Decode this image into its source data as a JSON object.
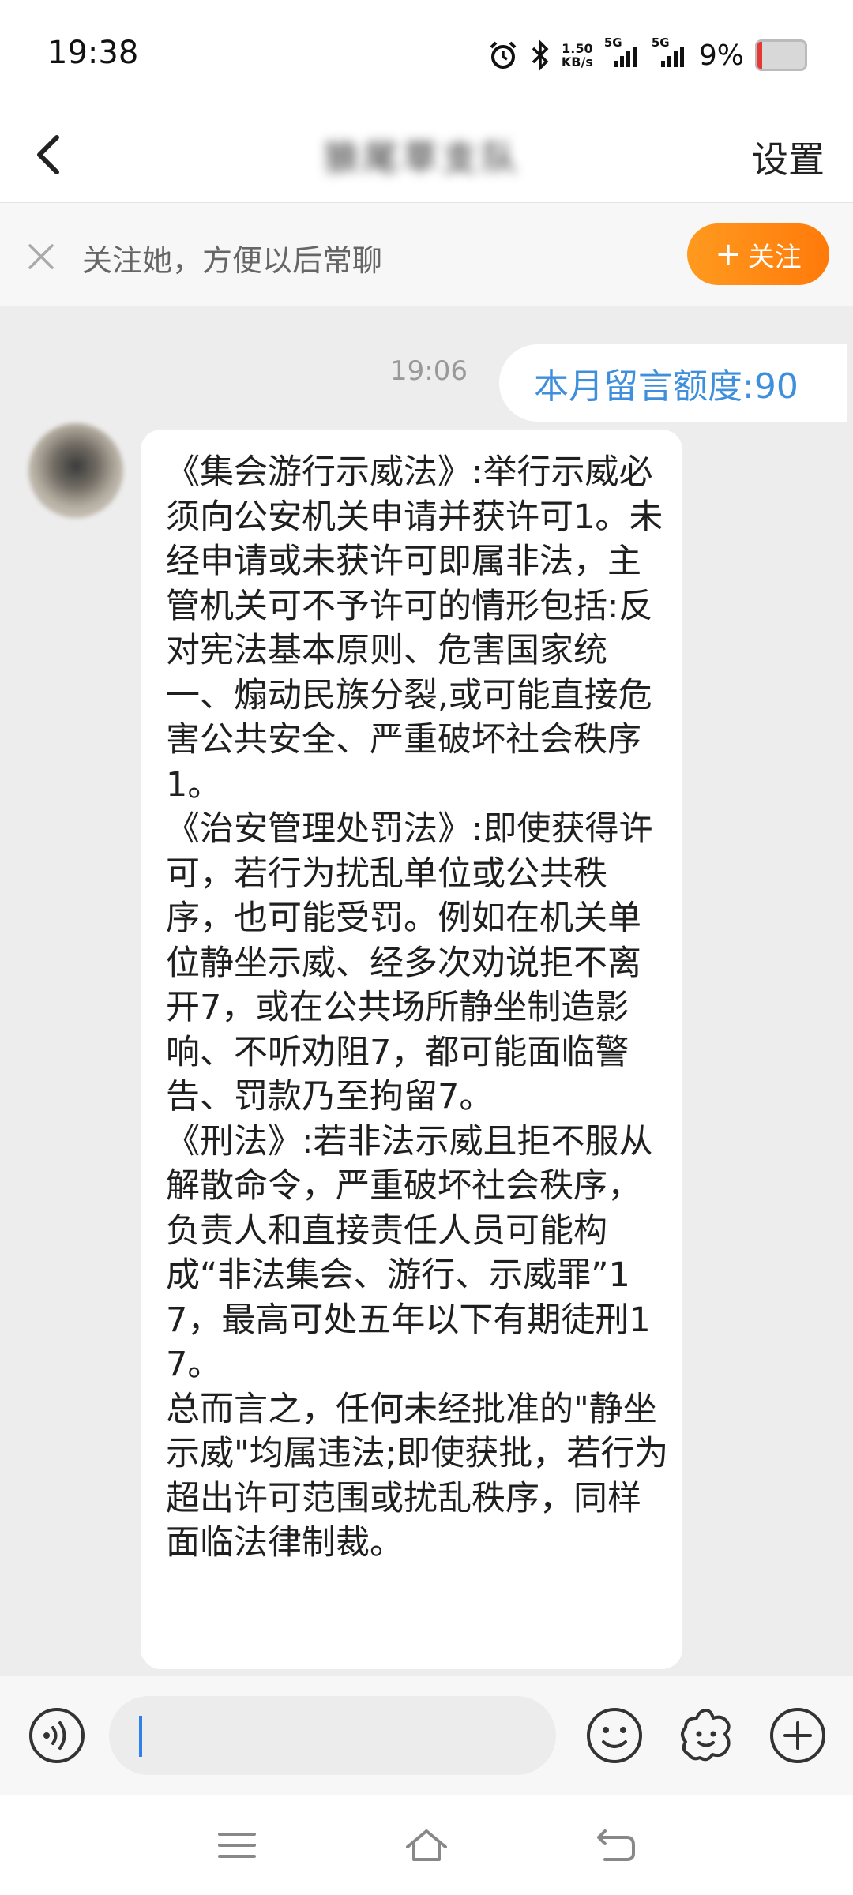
{
  "status_bar": {
    "time": "19:38",
    "net_speed_value": "1.50",
    "net_speed_unit": "KB/s",
    "sim1": "5G",
    "sim2": "5G",
    "battery_percent": "9%",
    "icons": [
      "alarm-icon",
      "bluetooth-icon",
      "signal-icon",
      "battery-icon"
    ]
  },
  "header": {
    "title": "狼尾草支队",
    "settings_label": "设置"
  },
  "follow_banner": {
    "text": "关注她，方便以后常聊",
    "button_label": "关注",
    "button_color": "#ff8a14"
  },
  "chat": {
    "timestamp": "19:06",
    "outgoing_message": "本月留言额度:90",
    "incoming_message": "《集会游行示威法》:举行示威必须向公安机关申请并获许可1。未经申请或未获许可即属非法，主管机关可不予许可的情形包括:反对宪法基本原则、危害国家统一、煽动民族分裂,或可能直接危害公共安全、严重破坏社会秩序1。\n《治安管理处罚法》:即使获得许可，若行为扰乱单位或公共秩序，也可能受罚。例如在机关单位静坐示威、经多次劝说拒不离开7，或在公共场所静坐制造影响、不听劝阻7，都可能面临警告、罚款乃至拘留7。\n《刑法》:若非法示威且拒不服从解散命令，严重破坏社会秩序，负责人和直接责任人员可能构成“非法集会、游行、示威罪”17，最高可处五年以下有期徒刑17。\n总而言之，任何未经批准的\"静坐示威\"均属违法;即使获批，若行为超出许可范围或扰乱秩序，同样面临法律制裁。"
  },
  "input_bar": {
    "value": "",
    "icons": [
      "voice-icon",
      "emoji-icon",
      "sticker-icon",
      "add-icon"
    ]
  },
  "nav_bar": {
    "icons": [
      "menu-icon",
      "home-icon",
      "back-nav-icon"
    ]
  },
  "colors": {
    "accent_blue": "#3f8fdc",
    "background": "#ededed"
  }
}
